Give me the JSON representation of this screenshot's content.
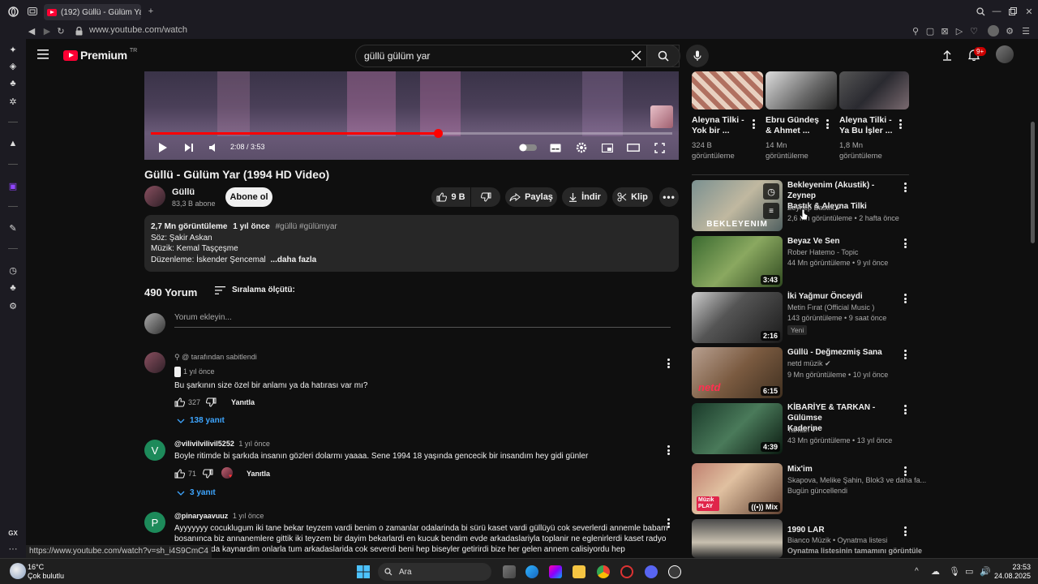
{
  "browser": {
    "tab_title": "(192) Güllü - Gülüm Yar (",
    "url": "www.youtube.com/watch",
    "status_url": "https://www.youtube.com/watch?v=sh_i4S9CmC4"
  },
  "header": {
    "logo_text": "Premium",
    "logo_region": "TR",
    "search_value": "güllü gülüm yar",
    "notification_badge": "9+"
  },
  "player": {
    "time": "2:08 / 3:53",
    "progress": 0.55
  },
  "video": {
    "title": "Güllü - Gülüm Yar (1994 HD Video)",
    "channel": "Güllü",
    "subscribers": "83,3 B abone",
    "subscribe_label": "Abone ol",
    "likes": "9 B",
    "share_label": "Paylaş",
    "download_label": "İndir",
    "clip_label": "Klip"
  },
  "description": {
    "views": "2,7 Mn görüntüleme",
    "age": "1 yıl önce",
    "tags": "#güllü #gülümyar",
    "line1": "Söz: Şakir Askan",
    "line2": "Müzik: Kemal Taşçeşme",
    "line3": "Düzenleme: İskender Şencemal",
    "more": "...daha fazla"
  },
  "comments_section": {
    "count": "490 Yorum",
    "sort_label": "Sıralama ölçütü:",
    "add_placeholder": "Yorum ekleyin..."
  },
  "comments": [
    {
      "pinned": "@ tarafından sabitlendi",
      "age": "1 yıl önce",
      "text": "Bu şarkının size özel bir anlamı ya da hatırası var mı?",
      "likes": "327",
      "reply_label": "Yanıtla",
      "replies": "138 yanıt"
    },
    {
      "avatar_letter": "V",
      "author": "@vilivilvilivil5252",
      "age": "1 yıl önce",
      "text": "Boyle ritimde bi şarkıda insanın gözleri dolarmı yaaaa. Sene 1994 18 yaşında gencecik bir insandım hey gidi günler",
      "likes": "71",
      "reply_label": "Yanıtla",
      "replies": "3 yanıt"
    },
    {
      "avatar_letter": "P",
      "author": "@pinaryaavuuz",
      "age": "1 yıl önce",
      "text1": "Ayyyyyyy cocuklugum iki tane bekar teyzem vardi benim o zamanlar odalarinda bi sürü kaset vardi güllüyü cok severlerdi annemle babam",
      "text2": "bosanınca biz annanemlere gittik iki teyzem bir dayim bekarlardi en kucuk bendim evde arkadaslariyla toplanir ne eglenirlerdi kaset radyo",
      "text3": "bende arada kaynardim onlarla tum arkadaslarida cok severdi beni hep biseyler getirirdi bize her gelen annem calisiyordu hep"
    }
  ],
  "top_row": [
    {
      "title1": "Aleyna Tilki -",
      "title2": "Yok bir ...",
      "views1": "324 B",
      "views2": "görüntüleme"
    },
    {
      "title1": "Ebru Gündeş",
      "title2": "& Ahmet ...",
      "views1": "14 Mn",
      "views2": "görüntüleme"
    },
    {
      "title1": "Aleyna Tilki -",
      "title2": "Ya Bu İşler ...",
      "views1": "1,8 Mn",
      "views2": "görüntüleme"
    }
  ],
  "recommended": [
    {
      "title1": "Bekleyenim (Akustik) - Zeynep",
      "title2": "Bastık & Aleyna Tilki",
      "channel": "Zeynep Bastık",
      "meta": "2,6 Mn görüntüleme • 2 hafta önce",
      "thumb_text": "BEKLEYENIM"
    },
    {
      "title1": "Beyaz Ve Sen",
      "channel": "Rober Hatemo - Topic",
      "meta": "44 Mn görüntüleme • 9 yıl önce",
      "duration": "3:43"
    },
    {
      "title1": "İki Yağmur Önceydi",
      "channel": "Metin Fırat (Official Music )",
      "meta": "143 görüntüleme • 9 saat önce",
      "badge": "Yeni",
      "duration": "2:16"
    },
    {
      "title1": "Güllü - Değmezmiş Sana",
      "channel": "netd müzik",
      "meta": "9 Mn görüntüleme • 10 yıl önce",
      "duration": "6:15",
      "thumb_text": "netd"
    },
    {
      "title1": "KİBARİYE & TARKAN - Gülümse",
      "title2": "Kaderine",
      "channel": "Tarkan",
      "meta": "43 Mn görüntüleme • 13 yıl önce",
      "duration": "4:39"
    },
    {
      "title1": "Mix'im",
      "channel": "Skapova, Melike Şahin, Blok3 ve daha fa...",
      "meta": "Bugün güncellendi",
      "duration": "Mix",
      "thumb_text": "Müzik PLAY"
    },
    {
      "title1": "1990 LAR",
      "channel": "Bianco Müzik • Oynatma listesi",
      "meta": "Oynatma listesinin tamamını görüntüle"
    }
  ],
  "taskbar": {
    "temp": "16°C",
    "weather": "Çok bulutlu",
    "search_label": "Ara",
    "time": "23:53",
    "date": "24.08.2025"
  },
  "colors": {
    "accent": "#ff0000",
    "link": "#3ea6ff",
    "background": "#0f0f0f"
  }
}
